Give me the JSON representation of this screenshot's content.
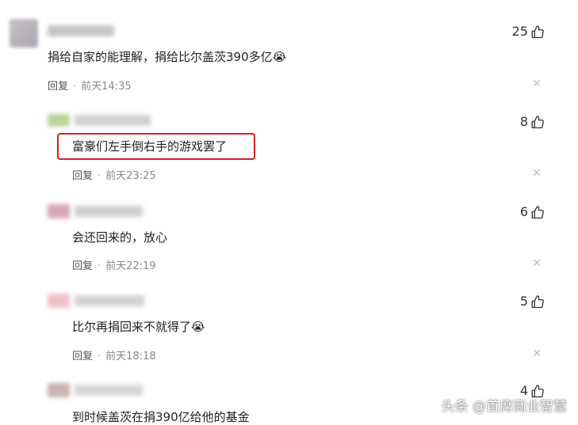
{
  "comments": [
    {
      "text": "捐给自家的能理解，捐给比尔盖茨390多亿",
      "emoji": "😭",
      "reply": "回复",
      "time": "前天14:35",
      "likes": "25"
    },
    {
      "text": "富豪们左手倒右手的游戏罢了",
      "emoji": "",
      "reply": "回复",
      "time": "前天23:25",
      "likes": "8"
    },
    {
      "text": "会还回来的，放心",
      "emoji": "",
      "reply": "回复",
      "time": "前天22:19",
      "likes": "6"
    },
    {
      "text": "比尔再捐回来不就得了",
      "emoji": "😭",
      "reply": "回复",
      "time": "前天18:18",
      "likes": "5"
    },
    {
      "text": "到时候盖茨在捐390亿给他的基金",
      "emoji": "",
      "reply": "",
      "time": "",
      "likes": "4"
    }
  ],
  "separator": "·",
  "close_glyph": "✕",
  "watermark": "头条 @首席商业智慧",
  "colors": {
    "highlight": "#d9211e",
    "muted": "#888888"
  }
}
